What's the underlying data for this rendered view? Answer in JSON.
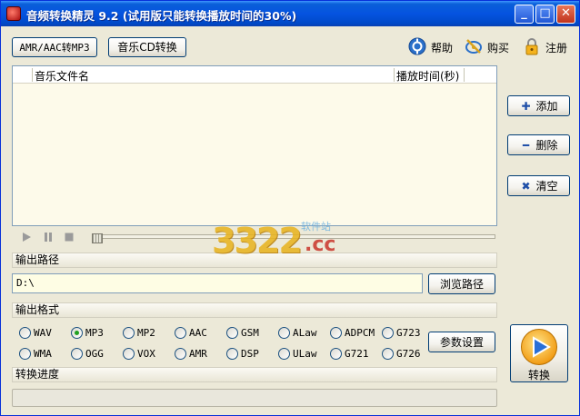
{
  "window": {
    "title": "音频转换精灵 9.2 (试用版只能转换播放时间的30%)",
    "min_glyph": "_",
    "max_glyph": "□",
    "close_glyph": "✕"
  },
  "toolbar": {
    "amr_button": "AMR/AAC转MP3",
    "cd_button": "音乐CD转换",
    "help_label": "帮助",
    "buy_label": "购买",
    "register_label": "注册"
  },
  "file_list": {
    "col_name": "音乐文件名",
    "col_time": "播放时间(秒)"
  },
  "side_buttons": {
    "add": "添加",
    "add_symbol": "✚",
    "delete": "删除",
    "delete_symbol": "━",
    "clear": "清空",
    "clear_symbol": "✖"
  },
  "output_path": {
    "section_label": "输出路径",
    "value": "D:\\",
    "browse_button": "浏览路径"
  },
  "output_format": {
    "section_label": "输出格式",
    "selected": "MP3",
    "row1": [
      "WAV",
      "MP3",
      "MP2",
      "AAC",
      "GSM",
      "ALaw",
      "ADPCM",
      "G723"
    ],
    "row2": [
      "WMA",
      "OGG",
      "VOX",
      "AMR",
      "DSP",
      "ULaw",
      "G721",
      "G726"
    ],
    "params_button": "参数设置"
  },
  "progress": {
    "section_label": "转换进度",
    "value": 0
  },
  "convert_button": "转换",
  "watermark": {
    "number": "3322",
    "suffix": ".cc",
    "small": "软件站"
  },
  "colors": {
    "titlebar": "#0553e0",
    "window_bg": "#ece9d8",
    "list_bg": "#fdfaea",
    "input_bg": "#fefde4",
    "accent": "#1f4fa8"
  }
}
